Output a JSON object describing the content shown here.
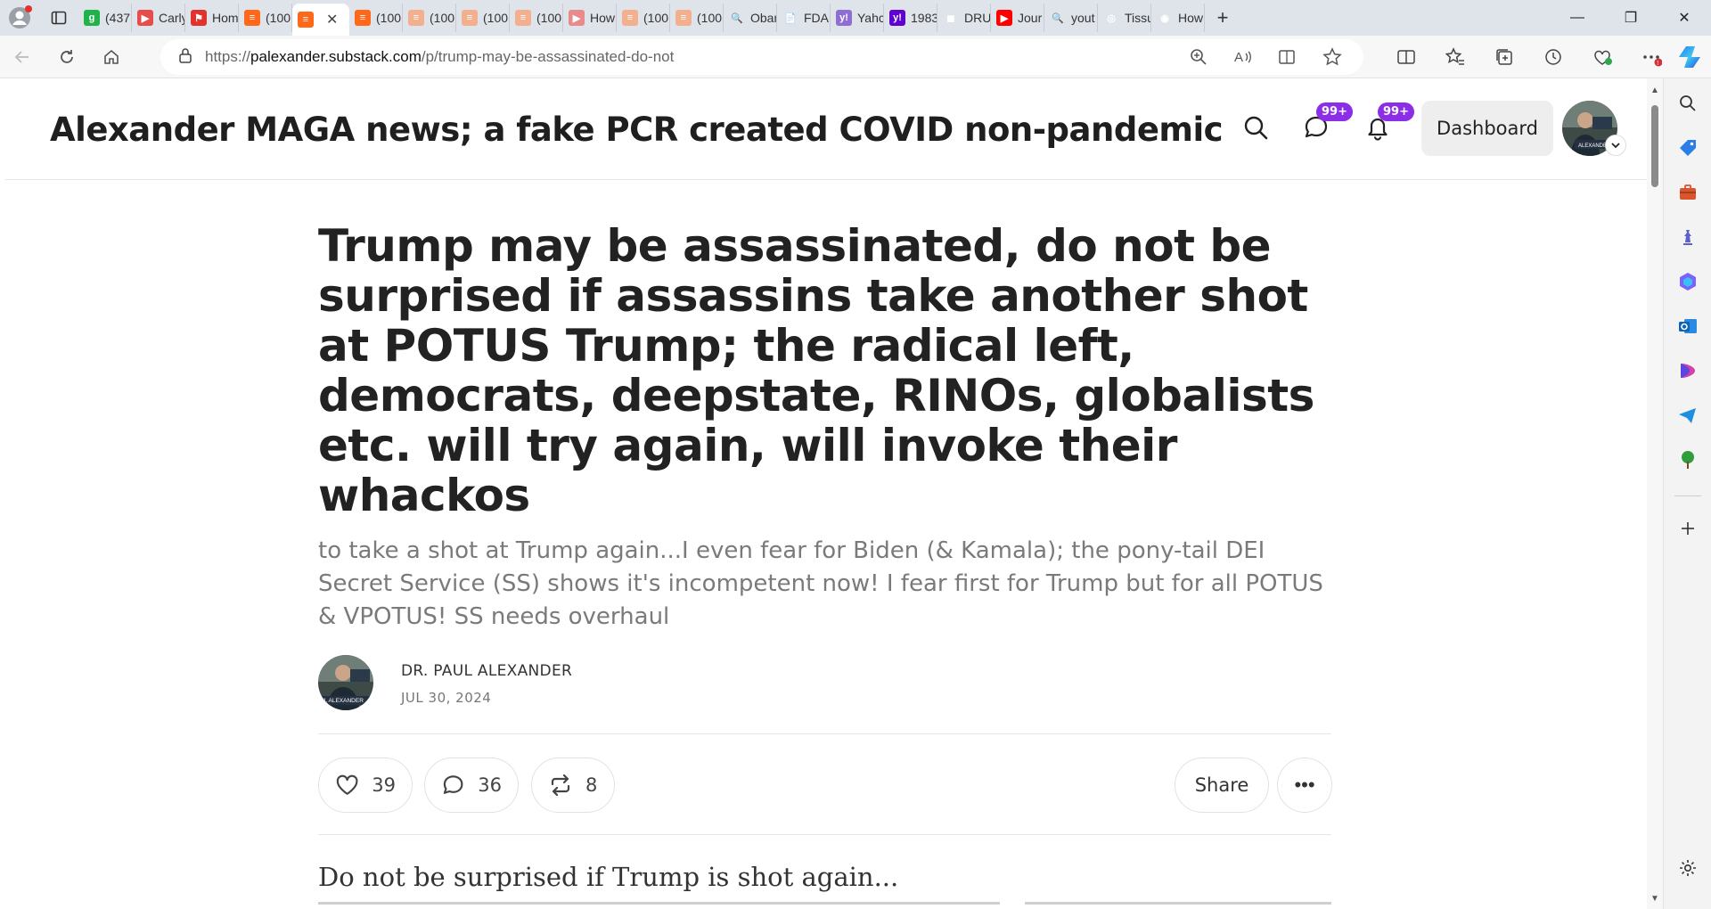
{
  "browser": {
    "tabs": [
      {
        "label": "(437",
        "color": "#21b34a",
        "glyph": "g"
      },
      {
        "label": "Carly",
        "color": "#e74c4c",
        "glyph": "▶"
      },
      {
        "label": "Hom",
        "color": "#e0322f",
        "glyph": "⚑"
      },
      {
        "label": "(100",
        "color": "#ff6719",
        "glyph": "≡"
      },
      {
        "label": "",
        "color": "#ff6719",
        "glyph": "≡",
        "active": true
      },
      {
        "label": "(100",
        "color": "#ff6719",
        "glyph": "≡"
      },
      {
        "label": "(100",
        "color": "#f3b08e",
        "glyph": "≡"
      },
      {
        "label": "(100",
        "color": "#f3b08e",
        "glyph": "≡"
      },
      {
        "label": "(100",
        "color": "#f3b08e",
        "glyph": "≡"
      },
      {
        "label": "How",
        "color": "#e78b8b",
        "glyph": "▶"
      },
      {
        "label": "(100",
        "color": "#f3b08e",
        "glyph": "≡"
      },
      {
        "label": "(100",
        "color": "#f3b08e",
        "glyph": "≡"
      },
      {
        "label": "Obar",
        "color": "#dfe3ea",
        "glyph": "🔍"
      },
      {
        "label": "FDA",
        "color": "#dfe3ea",
        "glyph": "📄"
      },
      {
        "label": "Yahc",
        "color": "#8e6fd1",
        "glyph": "y!"
      },
      {
        "label": "1983",
        "color": "#5f01d1",
        "glyph": "y!"
      },
      {
        "label": "DRU",
        "color": "#dfe3ea",
        "glyph": "◼"
      },
      {
        "label": "Jour",
        "color": "#ff0000",
        "glyph": "▶"
      },
      {
        "label": "yout",
        "color": "#dfe3ea",
        "glyph": "🔍"
      },
      {
        "label": "Tissu",
        "color": "#dfe3ea",
        "glyph": "◎"
      },
      {
        "label": "How",
        "color": "#dfe3ea",
        "glyph": "◉"
      }
    ],
    "url_prefix": "https://",
    "url_host": "palexander.substack.com",
    "url_path": "/p/trump-may-be-assassinated-do-not"
  },
  "site": {
    "title": "Alexander MAGA news; a fake PCR created COVID non-pandemic",
    "chat_badge": "99+",
    "notif_badge": "99+",
    "dashboard_label": "Dashboard",
    "avatar_caption": "ALEXANDER"
  },
  "post": {
    "title": "Trump may be assassinated, do not be surprised if assassins take another shot at POTUS Trump; the radical left, democrats, deepstate, RINOs, globalists etc. will try again, will invoke their whackos",
    "subtitle": "to take a shot at Trump again...I even fear for Biden (& Kamala); the pony-tail DEI Secret Service (SS) shows it's incompetent now! I fear first for Trump but for all POTUS & VPOTUS! SS needs overhaul",
    "author": "DR. PAUL ALEXANDER",
    "date": "JUL 30, 2024",
    "avatar_caption": "UL ALEXANDER",
    "likes": "39",
    "comments": "36",
    "restacks": "8",
    "share_label": "Share",
    "more_label": "•••",
    "body_first_line": "Do not be surprised if Trump is shot again..."
  },
  "colors": {
    "badge": "#8c2ee8",
    "substack": "#ff6719",
    "title_text": "#222222",
    "subtitle_text": "#7a7a7a"
  }
}
